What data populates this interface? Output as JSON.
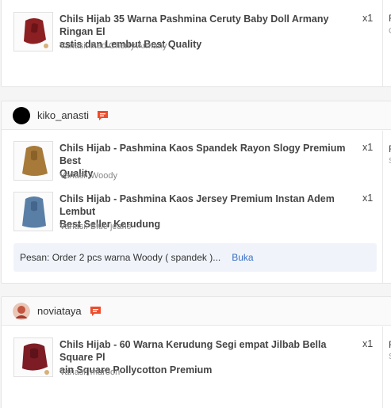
{
  "orders": [
    {
      "items": [
        {
          "title": "Chils Hijab 35 Warna Pashmina Ceruty Baby Doll Armany Ringan Elastis dan Lembut Best Quality",
          "title_line1": "Chils Hijab 35 Warna Pashmina Ceruty Baby Doll Armany Ringan El",
          "title_line2": "astis dan Lembut Best Quality",
          "variant": "Variasi: Red Cherry Armany",
          "qty": "x1",
          "color": "#8c1f22"
        }
      ],
      "right_col": [
        "R",
        "C"
      ]
    },
    {
      "username": "kiko_anasti",
      "avatar_color": "#000000",
      "items": [
        {
          "title_line1": "Chils Hijab - Pashmina Kaos Spandek Rayon Slogy Premium Best",
          "title_line2": "Quality",
          "variant": "Variasi: Woody",
          "qty": "x1",
          "color": "#a77a3a"
        },
        {
          "title_line1": "Chils Hijab - Pashmina Kaos Jersey Premium Instan Adem Lembut",
          "title_line2": "Best Seller Kerudung",
          "variant": "Variasi: Blue jeans",
          "qty": "x1",
          "color": "#5a7fa6"
        }
      ],
      "note": {
        "text": "Pesan: Order 2 pcs warna Woody ( spandek )...",
        "action": "Buka"
      },
      "right_col": [
        "R",
        "S"
      ]
    },
    {
      "username": "noviataya",
      "avatar_color": "#b5453a",
      "items": [
        {
          "title_line1": "Chils Hijab - 60 Warna Kerudung Segi empat Jilbab Bella Square Pl",
          "title_line2": "ain Square Pollycotton Premium",
          "variant": "Variasi: maroon",
          "qty": "x1",
          "color": "#7d1c24"
        }
      ],
      "right_col": [
        "R",
        "S"
      ]
    }
  ],
  "colors": {
    "chat": "#ee4d2d",
    "link": "#3a6fc4"
  }
}
